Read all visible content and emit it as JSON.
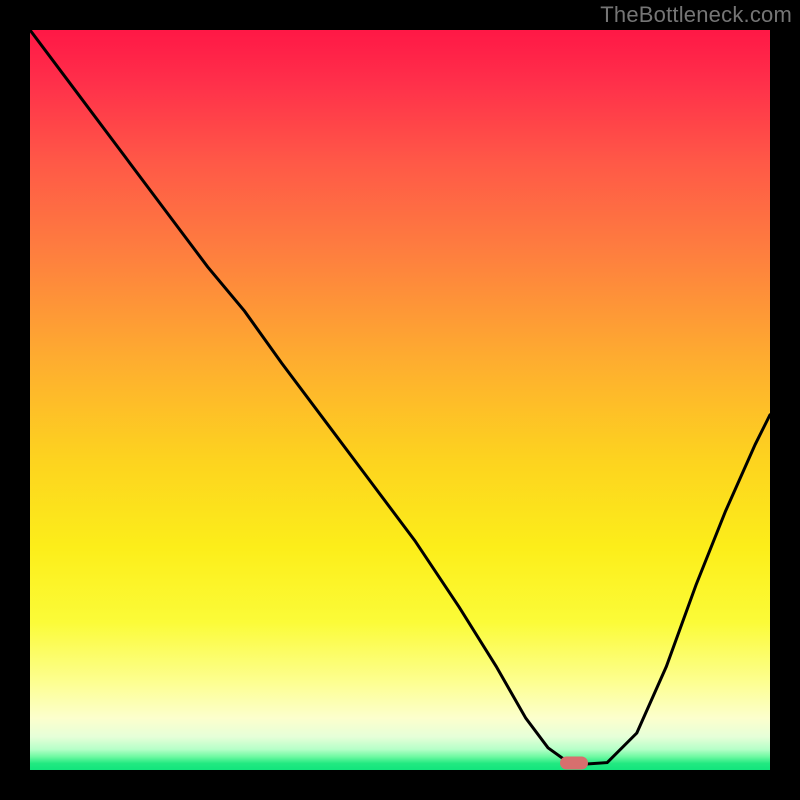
{
  "watermark": "TheBottleneck.com",
  "chart_data": {
    "type": "line",
    "title": "",
    "xlabel": "",
    "ylabel": "",
    "xlim": [
      0,
      100
    ],
    "ylim": [
      0,
      100
    ],
    "grid": false,
    "legend": false,
    "background_gradient": {
      "direction": "vertical",
      "stops": [
        {
          "pos": 0,
          "color": "#ff1846"
        },
        {
          "pos": 0.3,
          "color": "#fe7e3f"
        },
        {
          "pos": 0.58,
          "color": "#fdd31f"
        },
        {
          "pos": 0.88,
          "color": "#fdff8f"
        },
        {
          "pos": 1.0,
          "color": "#12e57d"
        }
      ]
    },
    "series": [
      {
        "name": "bottleneck-curve",
        "color": "#000000",
        "x": [
          0,
          6,
          12,
          18,
          24,
          29,
          34,
          40,
          46,
          52,
          58,
          63,
          67,
          70,
          72.5,
          75,
          78,
          82,
          86,
          90,
          94,
          98,
          100
        ],
        "y": [
          100,
          92,
          84,
          76,
          68,
          62,
          55,
          47,
          39,
          31,
          22,
          14,
          7,
          3,
          1.2,
          0.8,
          1.0,
          5,
          14,
          25,
          35,
          44,
          48
        ]
      }
    ],
    "marker": {
      "name": "optimal-point",
      "x": 73.5,
      "y": 0.9,
      "color": "#d76f6e",
      "shape": "capsule"
    }
  }
}
